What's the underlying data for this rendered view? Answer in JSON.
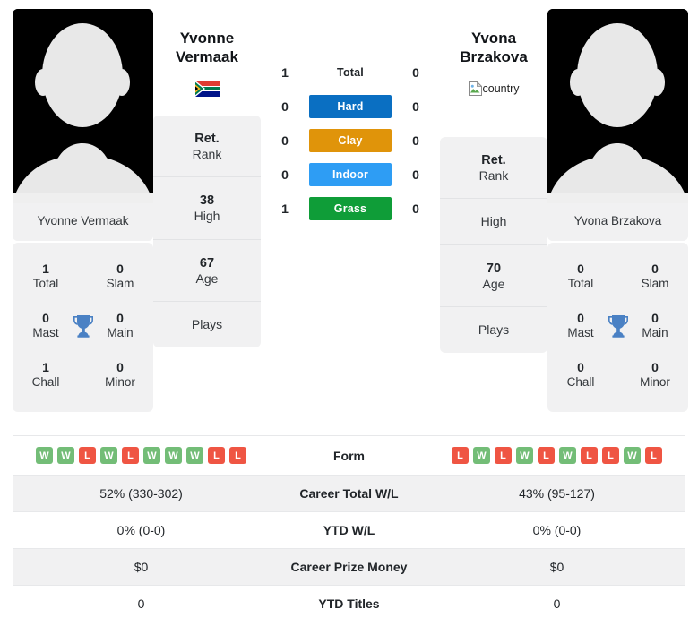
{
  "players": {
    "left": {
      "first_name": "Yvonne",
      "last_name": "Vermaak",
      "full_name": "Yvonne Vermaak",
      "country_code": "ZA",
      "country_alt": "country",
      "titles": {
        "total": "1",
        "total_label": "Total",
        "slam": "0",
        "slam_label": "Slam",
        "mast": "0",
        "mast_label": "Mast",
        "main": "0",
        "main_label": "Main",
        "chall": "1",
        "chall_label": "Chall",
        "minor": "0",
        "minor_label": "Minor"
      },
      "rank": {
        "current": "Ret.",
        "current_label": "Rank",
        "high": "38",
        "high_label": "High",
        "age": "67",
        "age_label": "Age",
        "plays": "",
        "plays_label": "Plays"
      },
      "surfaces": {
        "total": "1",
        "hard": "0",
        "clay": "0",
        "indoor": "0",
        "grass": "1"
      },
      "form": [
        "W",
        "W",
        "L",
        "W",
        "L",
        "W",
        "W",
        "W",
        "L",
        "L"
      ],
      "stats": {
        "career_wl": "52% (330-302)",
        "ytd_wl": "0% (0-0)",
        "prize": "$0",
        "ytd_titles": "0"
      }
    },
    "right": {
      "first_name": "Yvona",
      "last_name": "Brzakova",
      "full_name": "Yvona Brzakova",
      "country_code": "",
      "country_alt": "country",
      "titles": {
        "total": "0",
        "total_label": "Total",
        "slam": "0",
        "slam_label": "Slam",
        "mast": "0",
        "mast_label": "Mast",
        "main": "0",
        "main_label": "Main",
        "chall": "0",
        "chall_label": "Chall",
        "minor": "0",
        "minor_label": "Minor"
      },
      "rank": {
        "current": "Ret.",
        "current_label": "Rank",
        "high": "",
        "high_label": "High",
        "age": "70",
        "age_label": "Age",
        "plays": "",
        "plays_label": "Plays"
      },
      "surfaces": {
        "total": "0",
        "hard": "0",
        "clay": "0",
        "indoor": "0",
        "grass": "0"
      },
      "form": [
        "L",
        "W",
        "L",
        "W",
        "L",
        "W",
        "L",
        "L",
        "W",
        "L"
      ],
      "stats": {
        "career_wl": "43% (95-127)",
        "ytd_wl": "0% (0-0)",
        "prize": "$0",
        "ytd_titles": "0"
      }
    }
  },
  "surface_labels": {
    "total": "Total",
    "hard": "Hard",
    "clay": "Clay",
    "indoor": "Indoor",
    "grass": "Grass"
  },
  "surface_colors": {
    "hard": "#0a6fc2",
    "clay": "#e0940a",
    "indoor": "#2e9df4",
    "grass": "#0f9d38"
  },
  "form_colors": {
    "win": "#73bd77",
    "loss": "#ef5543"
  },
  "table_labels": {
    "form": "Form",
    "career_wl": "Career Total W/L",
    "ytd_wl": "YTD W/L",
    "prize": "Career Prize Money",
    "ytd_titles": "YTD Titles"
  },
  "icons": {
    "trophy": "trophy-icon",
    "flag": "flag-icon",
    "broken_image": "broken-image-icon"
  }
}
